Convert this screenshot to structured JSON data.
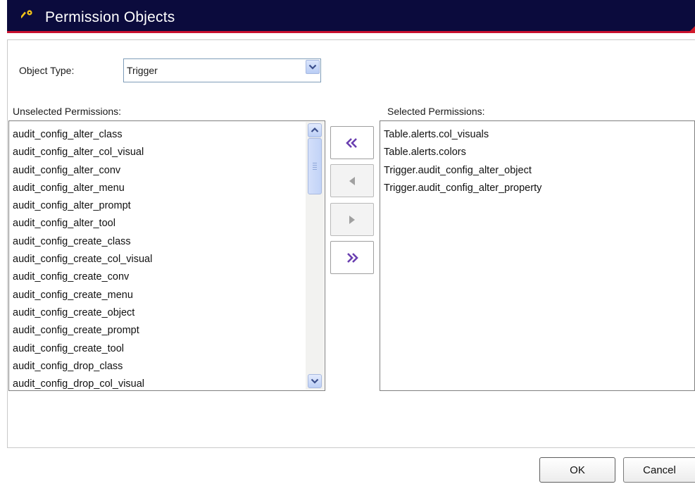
{
  "dialog": {
    "title": "Permission Objects",
    "title_icon": "key-icon"
  },
  "object_type": {
    "label": "Object Type:",
    "value": "Trigger"
  },
  "unselected": {
    "label": "Unselected Permissions:",
    "items": [
      "audit_config_alter_class",
      "audit_config_alter_col_visual",
      "audit_config_alter_conv",
      "audit_config_alter_menu",
      "audit_config_alter_prompt",
      "audit_config_alter_tool",
      "audit_config_create_class",
      "audit_config_create_col_visual",
      "audit_config_create_conv",
      "audit_config_create_menu",
      "audit_config_create_object",
      "audit_config_create_prompt",
      "audit_config_create_tool",
      "audit_config_drop_class",
      "audit_config_drop_col_visual"
    ]
  },
  "selected": {
    "label": "Selected Permissions:",
    "items": [
      "Table.alerts.col_visuals",
      "Table.alerts.colors",
      "Trigger.audit_config_alter_object",
      "Trigger.audit_config_alter_property"
    ]
  },
  "movers": [
    {
      "icon": "double-left-arrow-icon",
      "enabled": true
    },
    {
      "icon": "left-arrow-icon",
      "enabled": false
    },
    {
      "icon": "right-arrow-icon",
      "enabled": false
    },
    {
      "icon": "double-right-arrow-icon",
      "enabled": true
    }
  ],
  "buttons": {
    "ok": "OK",
    "cancel": "Cancel"
  },
  "colors": {
    "titlebar": "#0b0b3d",
    "accent": "#c8102e",
    "arrow_active": "#6a3fb0",
    "arrow_disabled": "#a0a0a0"
  }
}
